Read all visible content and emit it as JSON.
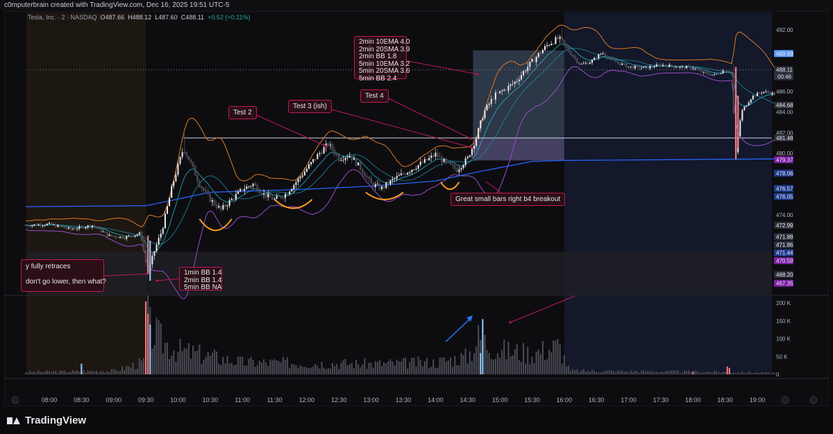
{
  "header": {
    "credit": "c0mputerbrain created with TradingView.com, Dec 16, 2025 19:51 UTC-5"
  },
  "legend": {
    "symbol": "Tesla, Inc. · 2 · NASDAQ",
    "open": "O487.66",
    "high": "H488.12",
    "low": "L487.60",
    "close": "C488.11",
    "change": "+0.52 (+0.11%)"
  },
  "footer": {
    "brand": "TradingView"
  },
  "annotations": {
    "indicators_box": [
      "2min 10EMA 4.0",
      "2min 20SMA 3.9",
      "2min BB 1.8",
      "5min 10EMA 3.2",
      "5min 20SMA 3.6",
      "5min BB 2.4"
    ],
    "test2": "Test 2",
    "test3": "Test 3 (ish)",
    "test4": "Test 4",
    "small_bars": "Great small bars right b4 breakout",
    "retrace_line1": "y fully retraces",
    "retrace_line2": "don't go lower, then what?",
    "bb_box": [
      "1min BB 1.4",
      "2min BB 1.4",
      "5min BB NA"
    ]
  },
  "colors": {
    "background": "#0d0d10",
    "up_candle": "#e6e6ea",
    "down_candle": "#3a3a42",
    "bb_upper": "#e07b24",
    "bb_lower": "#9c4dcc",
    "ema": "#26c6da",
    "sma": "#c9ccd3",
    "vwap": "#2962ff",
    "annotation_border": "#c2185b",
    "premarket_shade": "#2b2014",
    "afterhours_shade": "#141a2e",
    "volume_bar": "#4a4a55",
    "volume_highlight_red": "#f77c80",
    "volume_highlight_blue": "#90caf9",
    "arrow_blue": "#2979ff"
  },
  "chart_data": {
    "type": "candlestick",
    "title": "Tesla, Inc. · 2 · NASDAQ",
    "x_ticks": [
      "08:00",
      "08:30",
      "09:00",
      "09:30",
      "10:00",
      "10:30",
      "11:00",
      "11:30",
      "12:00",
      "12:30",
      "13:00",
      "13:30",
      "14:00",
      "14:30",
      "15:00",
      "15:30",
      "16:00",
      "16:30",
      "17:00",
      "17:30",
      "18:00",
      "18:30",
      "19:00"
    ],
    "y_ticks": [
      492.0,
      490.0,
      488.0,
      486.0,
      484.0,
      482.0,
      480.0,
      478.0,
      476.0,
      474.0
    ],
    "y_tick_labels": [
      "492.00",
      "486.00",
      "484.00",
      "482.00",
      "480.00",
      "474.00"
    ],
    "ylim": [
      467.0,
      493.0
    ],
    "volume_ticks": [
      "200 K",
      "150 K",
      "100 K",
      "50 K",
      "0"
    ],
    "volume_ylim": [
      0,
      210000
    ],
    "price_levels": [
      {
        "label": "489.69",
        "value": 489.69,
        "color": "#5b9cf6"
      },
      {
        "label": "488.11",
        "sub": "00:46",
        "value": 488.11,
        "color": "#2a2e39"
      },
      {
        "label": "484.68",
        "value": 484.68,
        "color": "#2a2e39"
      },
      {
        "label": "481.48",
        "value": 481.48,
        "color": "#2a2e39"
      },
      {
        "label": "479.37",
        "value": 479.37,
        "color": "#7b1fa2"
      },
      {
        "label": "478.06",
        "value": 478.06,
        "color": "#1e3a8a"
      },
      {
        "label": "476.57",
        "value": 476.57,
        "color": "#1e3a8a"
      },
      {
        "label": "476.05",
        "value": 476.05,
        "color": "#1e3a8a"
      },
      {
        "label": "472.99",
        "value": 472.99,
        "color": "#2a2e39"
      },
      {
        "label": "471.88",
        "value": 471.88,
        "color": "#2a2e39"
      },
      {
        "label": "471.86",
        "value": 471.86,
        "color": "#2a2e39"
      },
      {
        "label": "471.44",
        "value": 471.44,
        "color": "#1e3a8a"
      },
      {
        "label": "470.59",
        "value": 470.59,
        "color": "#7b1fa2"
      },
      {
        "label": "468.20",
        "value": 468.2,
        "color": "#2a2e39"
      },
      {
        "label": "467.35",
        "value": 467.35,
        "color": "#7b1fa2"
      }
    ],
    "horizontal_line": 481.48,
    "dotted_line": 488.11,
    "session_premarket": [
      "07:38",
      "09:30"
    ],
    "session_afterhours": [
      "16:00",
      "19:15"
    ],
    "breakout_box": {
      "t0": "14:35",
      "t1": "16:00",
      "p0": 479.3,
      "p1": 490.0
    },
    "price_anchors": [
      [
        "07:38",
        473.0
      ],
      [
        "08:00",
        473.1
      ],
      [
        "08:20",
        472.6
      ],
      [
        "08:40",
        473.0
      ],
      [
        "08:55",
        472.0
      ],
      [
        "09:10",
        471.8
      ],
      [
        "09:25",
        472.2
      ],
      [
        "09:32",
        468.3
      ],
      [
        "09:38",
        470.5
      ],
      [
        "09:45",
        472.5
      ],
      [
        "09:55",
        477.0
      ],
      [
        "10:05",
        480.5
      ],
      [
        "10:12",
        479.0
      ],
      [
        "10:20",
        477.0
      ],
      [
        "10:30",
        475.5
      ],
      [
        "10:40",
        474.5
      ],
      [
        "10:50",
        475.5
      ],
      [
        "11:00",
        476.5
      ],
      [
        "11:10",
        477.0
      ],
      [
        "11:20",
        476.0
      ],
      [
        "11:30",
        475.5
      ],
      [
        "11:40",
        476.0
      ],
      [
        "11:50",
        477.2
      ],
      [
        "12:00",
        478.5
      ],
      [
        "12:10",
        479.8
      ],
      [
        "12:20",
        480.9
      ],
      [
        "12:30",
        479.5
      ],
      [
        "12:40",
        479.8
      ],
      [
        "12:50",
        478.6
      ],
      [
        "13:00",
        477.0
      ],
      [
        "13:10",
        476.6
      ],
      [
        "13:20",
        477.4
      ],
      [
        "13:30",
        478.0
      ],
      [
        "13:40",
        478.6
      ],
      [
        "13:50",
        479.2
      ],
      [
        "14:00",
        479.9
      ],
      [
        "14:10",
        479.0
      ],
      [
        "14:20",
        478.4
      ],
      [
        "14:30",
        479.5
      ],
      [
        "14:38",
        481.5
      ],
      [
        "14:45",
        484.0
      ],
      [
        "14:55",
        485.6
      ],
      [
        "15:05",
        486.2
      ],
      [
        "15:15",
        487.0
      ],
      [
        "15:25",
        488.3
      ],
      [
        "15:35",
        489.5
      ],
      [
        "15:45",
        490.6
      ],
      [
        "15:55",
        491.2
      ],
      [
        "16:05",
        489.8
      ],
      [
        "16:15",
        488.6
      ],
      [
        "16:25",
        488.9
      ],
      [
        "16:35",
        489.8
      ],
      [
        "16:45",
        489.0
      ],
      [
        "17:00",
        488.4
      ],
      [
        "17:15",
        488.3
      ],
      [
        "17:30",
        488.6
      ],
      [
        "17:45",
        488.4
      ],
      [
        "18:00",
        488.3
      ],
      [
        "18:10",
        487.8
      ],
      [
        "18:20",
        487.6
      ],
      [
        "18:30",
        488.1
      ],
      [
        "18:36",
        487.8
      ],
      [
        "18:40",
        480.0
      ],
      [
        "18:45",
        484.0
      ],
      [
        "18:55",
        485.5
      ],
      [
        "19:05",
        486.0
      ],
      [
        "19:15",
        485.8
      ]
    ],
    "volume_anchors": [
      [
        "07:38",
        8000
      ],
      [
        "09:00",
        12000
      ],
      [
        "09:28",
        40000
      ],
      [
        "09:30",
        205000
      ],
      [
        "09:34",
        150000
      ],
      [
        "09:45",
        110000
      ],
      [
        "10:00",
        80000
      ],
      [
        "10:30",
        60000
      ],
      [
        "11:00",
        40000
      ],
      [
        "12:00",
        38000
      ],
      [
        "13:00",
        35000
      ],
      [
        "14:00",
        40000
      ],
      [
        "14:30",
        60000
      ],
      [
        "14:40",
        120000
      ],
      [
        "15:00",
        80000
      ],
      [
        "15:30",
        70000
      ],
      [
        "15:55",
        95000
      ],
      [
        "16:05",
        12000
      ],
      [
        "18:30",
        8000
      ],
      [
        "19:15",
        5000
      ]
    ],
    "volume_highlights": [
      {
        "time": "09:30",
        "value": 205000,
        "color": "red"
      },
      {
        "time": "09:32",
        "value": 170000,
        "color": "red"
      },
      {
        "time": "09:34",
        "value": 140000,
        "color": "blue"
      },
      {
        "time": "08:30",
        "value": 30000,
        "color": "blue"
      },
      {
        "time": "14:44",
        "value": 155000,
        "color": "blue"
      },
      {
        "time": "14:42",
        "value": 60000,
        "color": "blue"
      },
      {
        "time": "18:32",
        "value": 22000,
        "color": "red"
      },
      {
        "time": "18:34",
        "value": 18000,
        "color": "red"
      },
      {
        "time": "18:00",
        "value": 8000,
        "color": "red"
      }
    ]
  }
}
